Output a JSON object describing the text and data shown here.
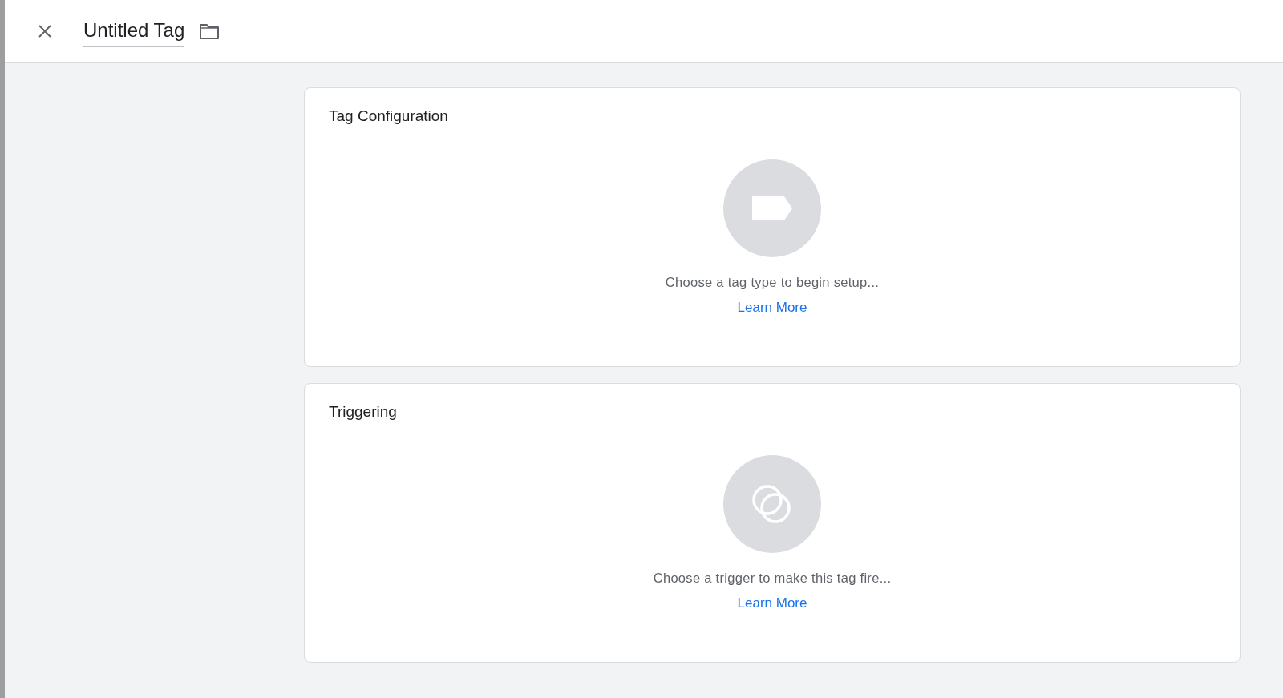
{
  "header": {
    "title": "Untitled Tag"
  },
  "sections": [
    {
      "kind": "tag",
      "title": "Tag Configuration",
      "prompt": "Choose a tag type to begin setup...",
      "link": "Learn More"
    },
    {
      "kind": "trigger",
      "title": "Triggering",
      "prompt": "Choose a trigger to make this tag fire...",
      "link": "Learn More"
    }
  ]
}
